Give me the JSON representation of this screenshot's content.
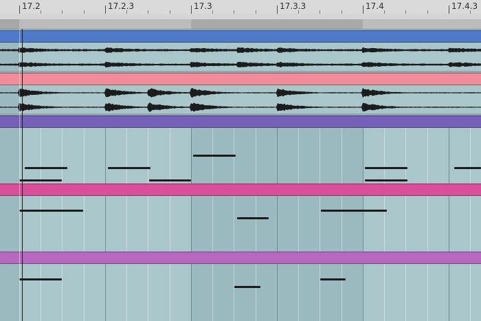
{
  "ruler": {
    "markers": [
      "17.2",
      "17.2.3",
      "17.3",
      "17.3.3",
      "17.4",
      "17.4.3"
    ]
  },
  "tracks": [
    {
      "kind": "audio",
      "color": "#4f7ac9",
      "label": ""
    },
    {
      "kind": "audio",
      "color": "#f28b9a",
      "label": ""
    },
    {
      "kind": "midi",
      "color": "#7562b8",
      "label": ""
    },
    {
      "kind": "midi",
      "color": "#d94f9a",
      "label": ""
    },
    {
      "kind": "midi",
      "color": "#b56abf",
      "label": ""
    }
  ],
  "colors": {
    "clip_body": "#a9c6cb",
    "ruler": "#d6d6d6",
    "note": "#1c1c1c",
    "playhead": "#1a1a1a"
  }
}
